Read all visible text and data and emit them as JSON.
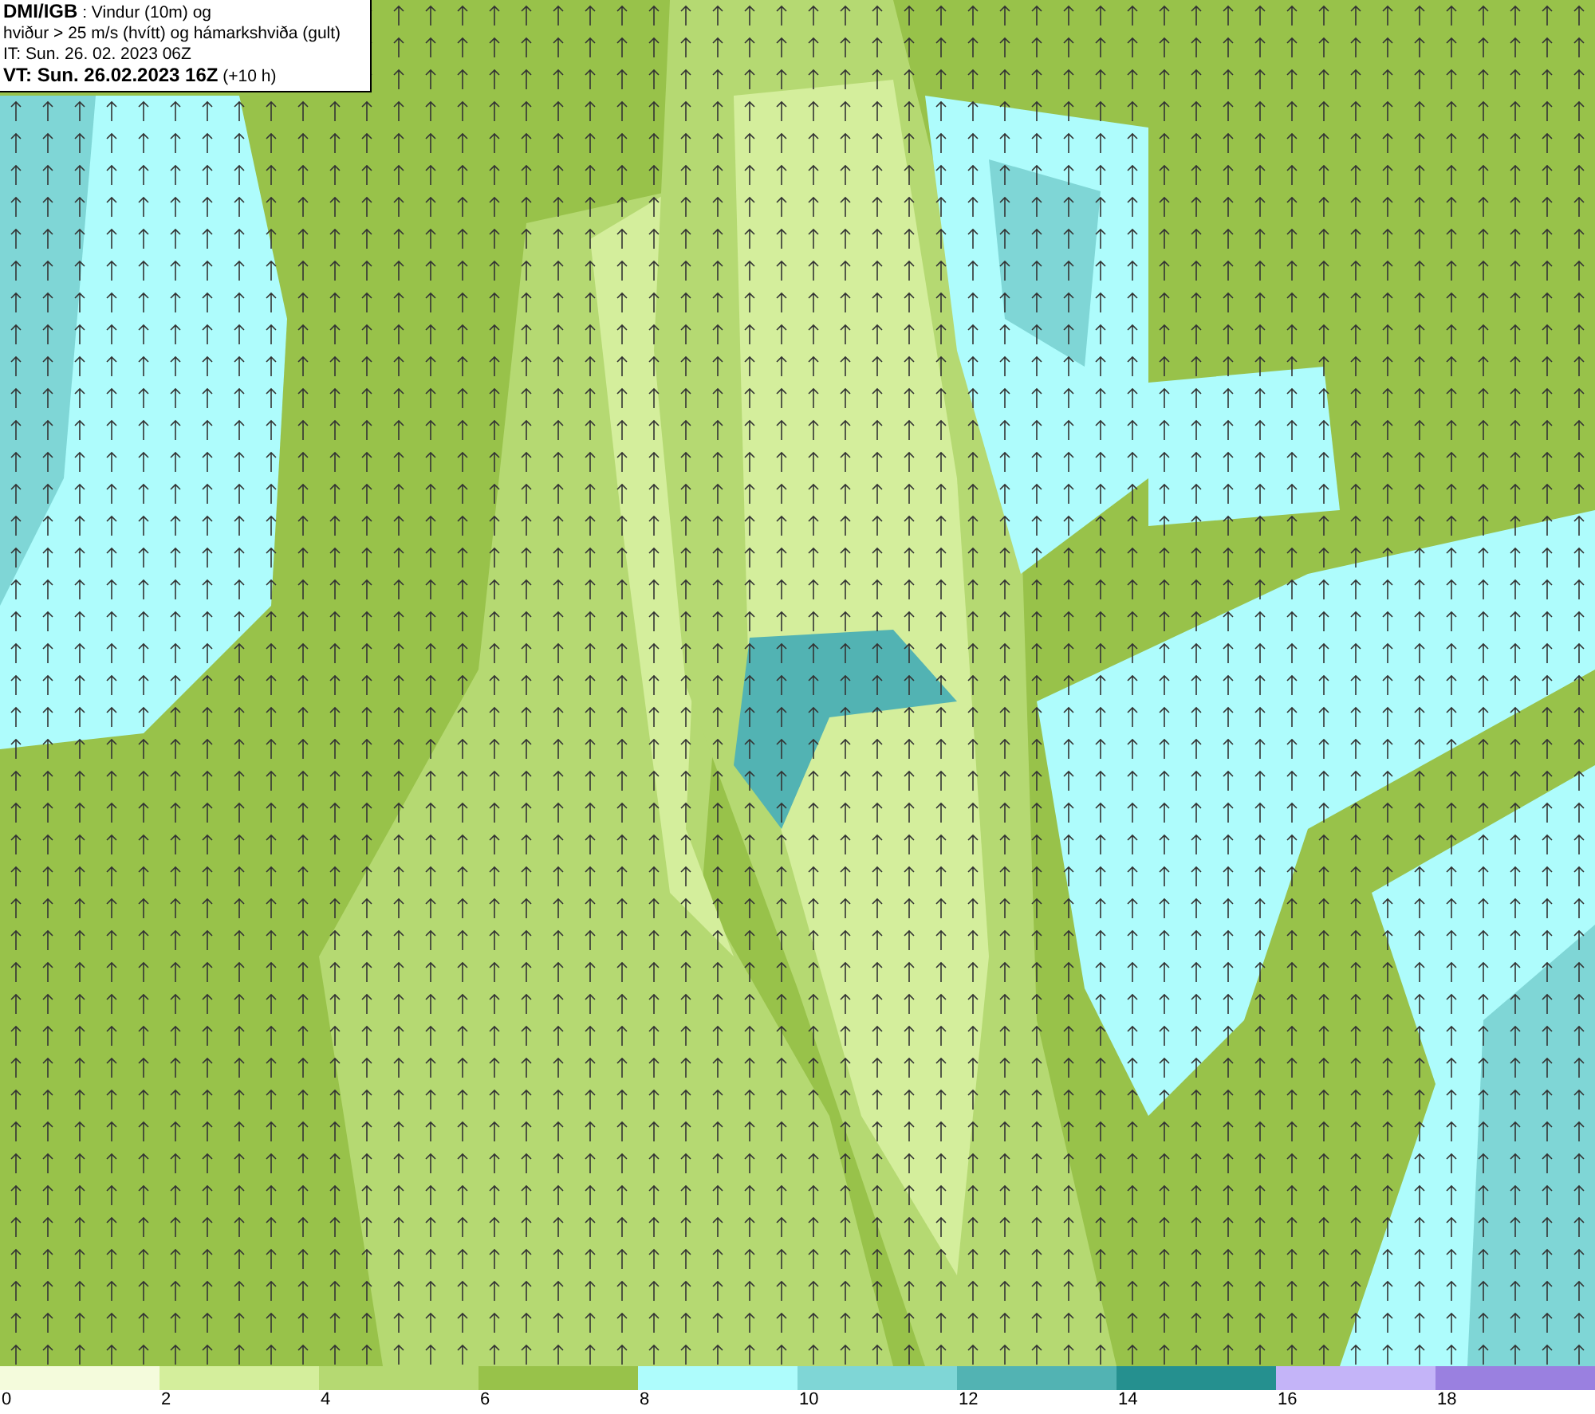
{
  "header": {
    "lines": [
      "**DMI/IGB** : Vindur (10m) og",
      "hviður > 25 m/s (hvítt) og hámarkshviða (gult)",
      "IT: Sun. 26. 02. 2023 06Z",
      "**VT: Sun. 26.02.2023 16Z** (+10 h)"
    ]
  },
  "legend": [
    {
      "label": "0",
      "color": "#f4fbdc"
    },
    {
      "label": "2",
      "color": "#d4ee9c"
    },
    {
      "label": "4",
      "color": "#b5d972"
    },
    {
      "label": "6",
      "color": "#98c24a"
    },
    {
      "label": "8",
      "color": "#aefcfc"
    },
    {
      "label": "10",
      "color": "#7fd6d6"
    },
    {
      "label": "12",
      "color": "#52b3b3"
    },
    {
      "label": "14",
      "color": "#25908f"
    },
    {
      "label": "16",
      "color": "#c4b4f8"
    },
    {
      "label": "18",
      "color": "#9a80e0"
    }
  ]
}
